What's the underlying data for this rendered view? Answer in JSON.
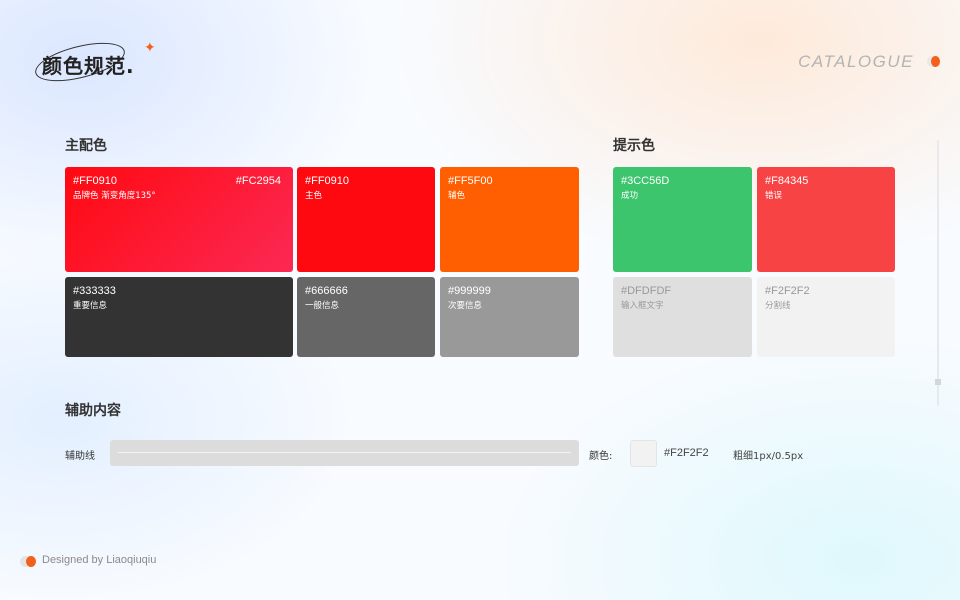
{
  "header": {
    "title": "颜色规范.",
    "catalogue": "CATALOGUE"
  },
  "primary": {
    "title": "主配色",
    "swatches": [
      {
        "code": "#FF0910",
        "code2": "#FC2954",
        "name": "品牌色  渐变角度135°",
        "color": "#FF0910",
        "color2": "#FC2954"
      },
      {
        "code": "#FF0910",
        "name": "主色",
        "color": "#FF0910"
      },
      {
        "code": "#FF5F00",
        "name": "辅色",
        "color": "#FF5F00"
      },
      {
        "code": "#333333",
        "name": "重要信息",
        "color": "#333333"
      },
      {
        "code": "#666666",
        "name": "一般信息",
        "color": "#666666"
      },
      {
        "code": "#999999",
        "name": "次要信息",
        "color": "#999999"
      }
    ]
  },
  "hint": {
    "title": "提示色",
    "swatches": [
      {
        "code": "#3CC56D",
        "name": "成功",
        "color": "#3CC56D"
      },
      {
        "code": "#F84345",
        "name": "错误",
        "color": "#F84345"
      },
      {
        "code": "#DFDFDF",
        "name": "输入框文字",
        "color": "#DFDFDF"
      },
      {
        "code": "#F2F2F2",
        "name": "分割线",
        "color": "#F2F2F2"
      }
    ]
  },
  "auxiliary": {
    "title": "辅助内容",
    "line_label": "辅助线",
    "color_label": "颜色:",
    "color_value": "#F2F2F2",
    "weight": "粗细1px/0.5px"
  },
  "footer": {
    "credit": "Designed by Liaoqiuqiu"
  },
  "accent_color": "#F2601C"
}
